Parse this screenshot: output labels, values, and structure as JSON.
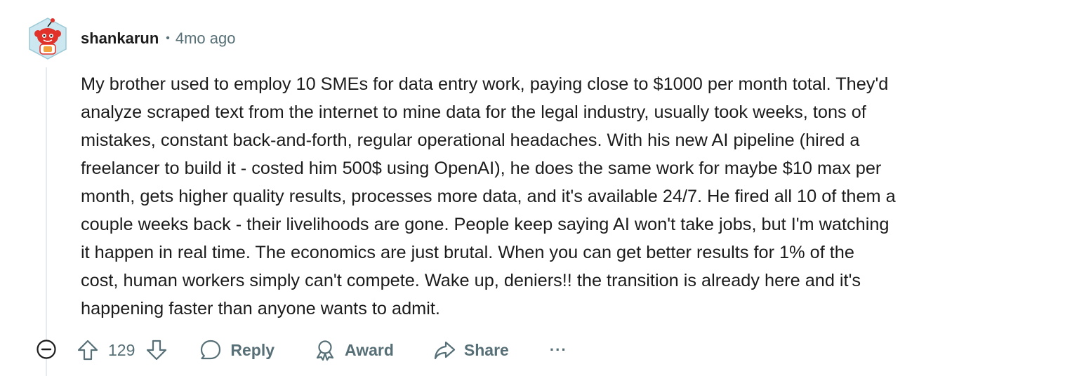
{
  "comment": {
    "author": "shankarun",
    "separator": "•",
    "time_ago": "4mo ago",
    "body": "My brother used to employ 10 SMEs for data entry work, paying close to $1000 per month total. They'd\nanalyze scraped text from the internet to mine data for the legal industry, usually took weeks, tons of\nmistakes, constant back-and-forth, regular operational headaches. With his new AI pipeline (hired a\nfreelancer to build it - costed him 500$ using OpenAI), he does the same work for maybe $10 max per\nmonth, gets higher quality results, processes more data, and it's available 24/7. He fired all 10 of them a\ncouple weeks back - their livelihoods are gone. People keep saying AI won't take jobs, but I'm watching\nit happen in real time. The economics are just brutal. When you can get better results for 1% of the\ncost, human workers simply can't compete. Wake up, deniers!! the transition is already here and it's\nhappening faster than anyone wants to admit."
  },
  "actions": {
    "vote_count": "129",
    "reply_label": "Reply",
    "award_label": "Award",
    "share_label": "Share",
    "more_label": "···"
  },
  "icons": {
    "collapse": "minus-circle-icon",
    "upvote": "arrow-up-icon",
    "downvote": "arrow-down-icon",
    "reply": "speech-bubble-icon",
    "award": "award-ribbon-icon",
    "share": "share-arrow-icon"
  },
  "colors": {
    "text": "#1c1c1c",
    "meta": "#576f76",
    "thread_line": "#e5ebee",
    "avatar_red": "#e0312a"
  }
}
